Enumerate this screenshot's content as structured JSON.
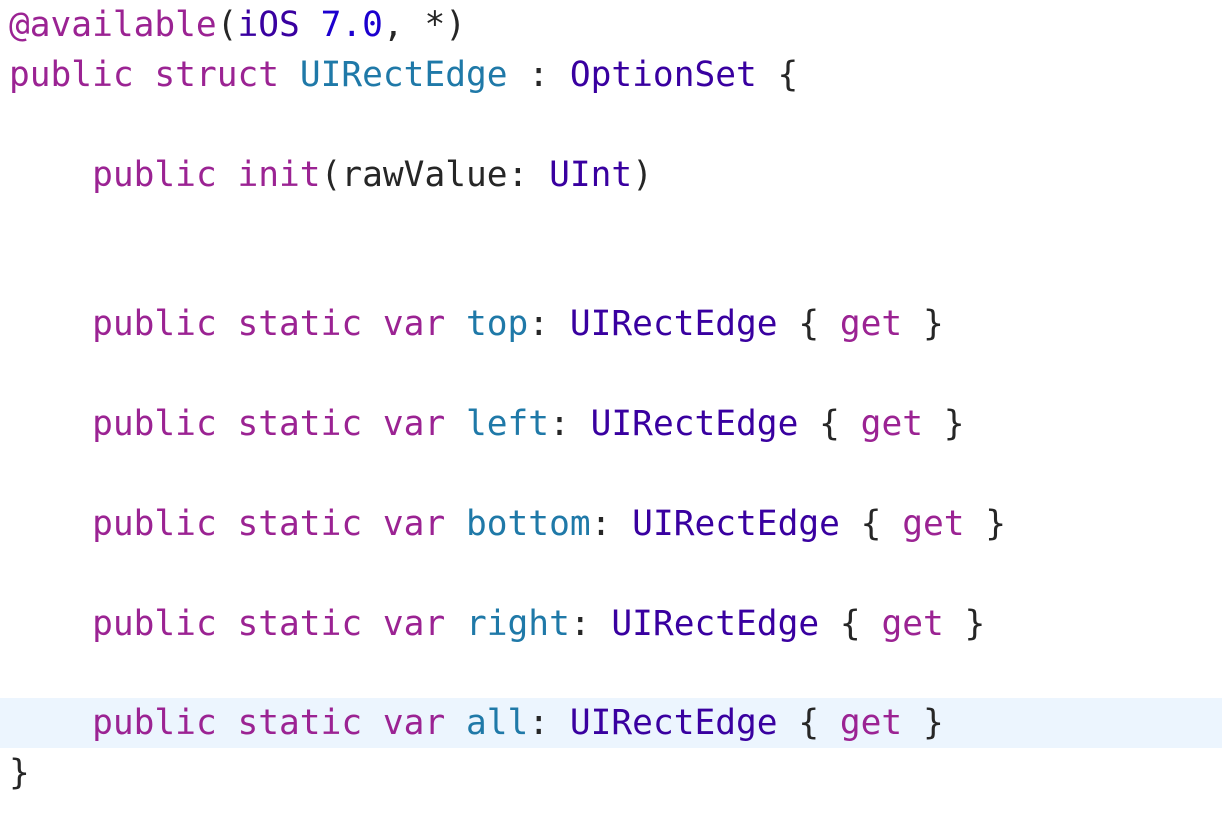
{
  "code": {
    "line1": {
      "attr": "@available",
      "open": "(",
      "platform": "iOS",
      "space": " ",
      "version": "7.0",
      "rest": ", *)"
    },
    "line2": {
      "kw1": "public",
      "kw2": "struct",
      "name": "UIRectEdge",
      "colon": " : ",
      "proto": "OptionSet",
      "brace": " {"
    },
    "line3": {
      "kw1": "public",
      "kw2": "init",
      "open": "(rawValue: ",
      "type": "UInt",
      "close": ")"
    },
    "properties": [
      {
        "name": "top",
        "type": "UIRectEdge",
        "accessor": "get"
      },
      {
        "name": "left",
        "type": "UIRectEdge",
        "accessor": "get"
      },
      {
        "name": "bottom",
        "type": "UIRectEdge",
        "accessor": "get"
      },
      {
        "name": "right",
        "type": "UIRectEdge",
        "accessor": "get"
      },
      {
        "name": "all",
        "type": "UIRectEdge",
        "accessor": "get"
      }
    ],
    "prop_keywords": {
      "public": "public",
      "static": "static",
      "var": "var"
    },
    "closing_brace": "}"
  },
  "colors": {
    "keyword": "#9b2393",
    "declaration": "#1f79a8",
    "type": "#3900a0",
    "number": "#1c00cf",
    "plain": "#262626",
    "current_line": "#ecf5fe"
  }
}
